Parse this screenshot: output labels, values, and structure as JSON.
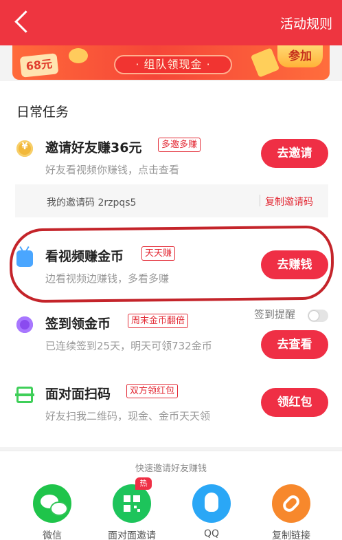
{
  "header": {
    "title": "活动规则"
  },
  "banner": {
    "badge_amount": "68元",
    "pill_text": "· 组队领现金 ·",
    "join_label": "参加"
  },
  "section": {
    "title": "日常任务"
  },
  "tasks": [
    {
      "title": "邀请好友赚36元",
      "tag": "多邀多赚",
      "desc": "好友看视频你赚钱，点击查看",
      "button": "去邀请",
      "icon": "coin-icon"
    },
    {
      "title": "看视频赚金币",
      "tag": "天天赚",
      "desc": "边看视频边赚钱，多看多赚",
      "button": "去赚钱",
      "icon": "tv-icon"
    },
    {
      "title": "签到领金币",
      "tag": "周末金币翻倍",
      "desc": "已连续签到25天，明天可领732金币",
      "button": "去查看",
      "icon": "map-pin-icon"
    },
    {
      "title": "面对面扫码",
      "tag": "双方领红包",
      "desc": "好友扫我二维码，现金、金币天天领",
      "button": "领红包",
      "icon": "scan-icon"
    }
  ],
  "invite": {
    "code_text": "我的邀请码 2rzpqs5",
    "copy_label": "复制邀请码"
  },
  "checkin": {
    "reminder_label": "签到提醒",
    "reminder_on": false
  },
  "share": {
    "title": "快速邀请好友赚钱",
    "items": [
      {
        "label": "微信",
        "color": "#1fc44a",
        "icon": "wechat-icon"
      },
      {
        "label": "面对面邀请",
        "color": "#1dc45b",
        "icon": "qr-code-icon",
        "badge": "热"
      },
      {
        "label": "QQ",
        "color": "#2aa7f6",
        "icon": "qq-icon"
      },
      {
        "label": "复制链接",
        "color": "#f7882c",
        "icon": "link-icon"
      }
    ]
  },
  "colors": {
    "primary": "#ee3540",
    "button": "#ef2f45"
  }
}
